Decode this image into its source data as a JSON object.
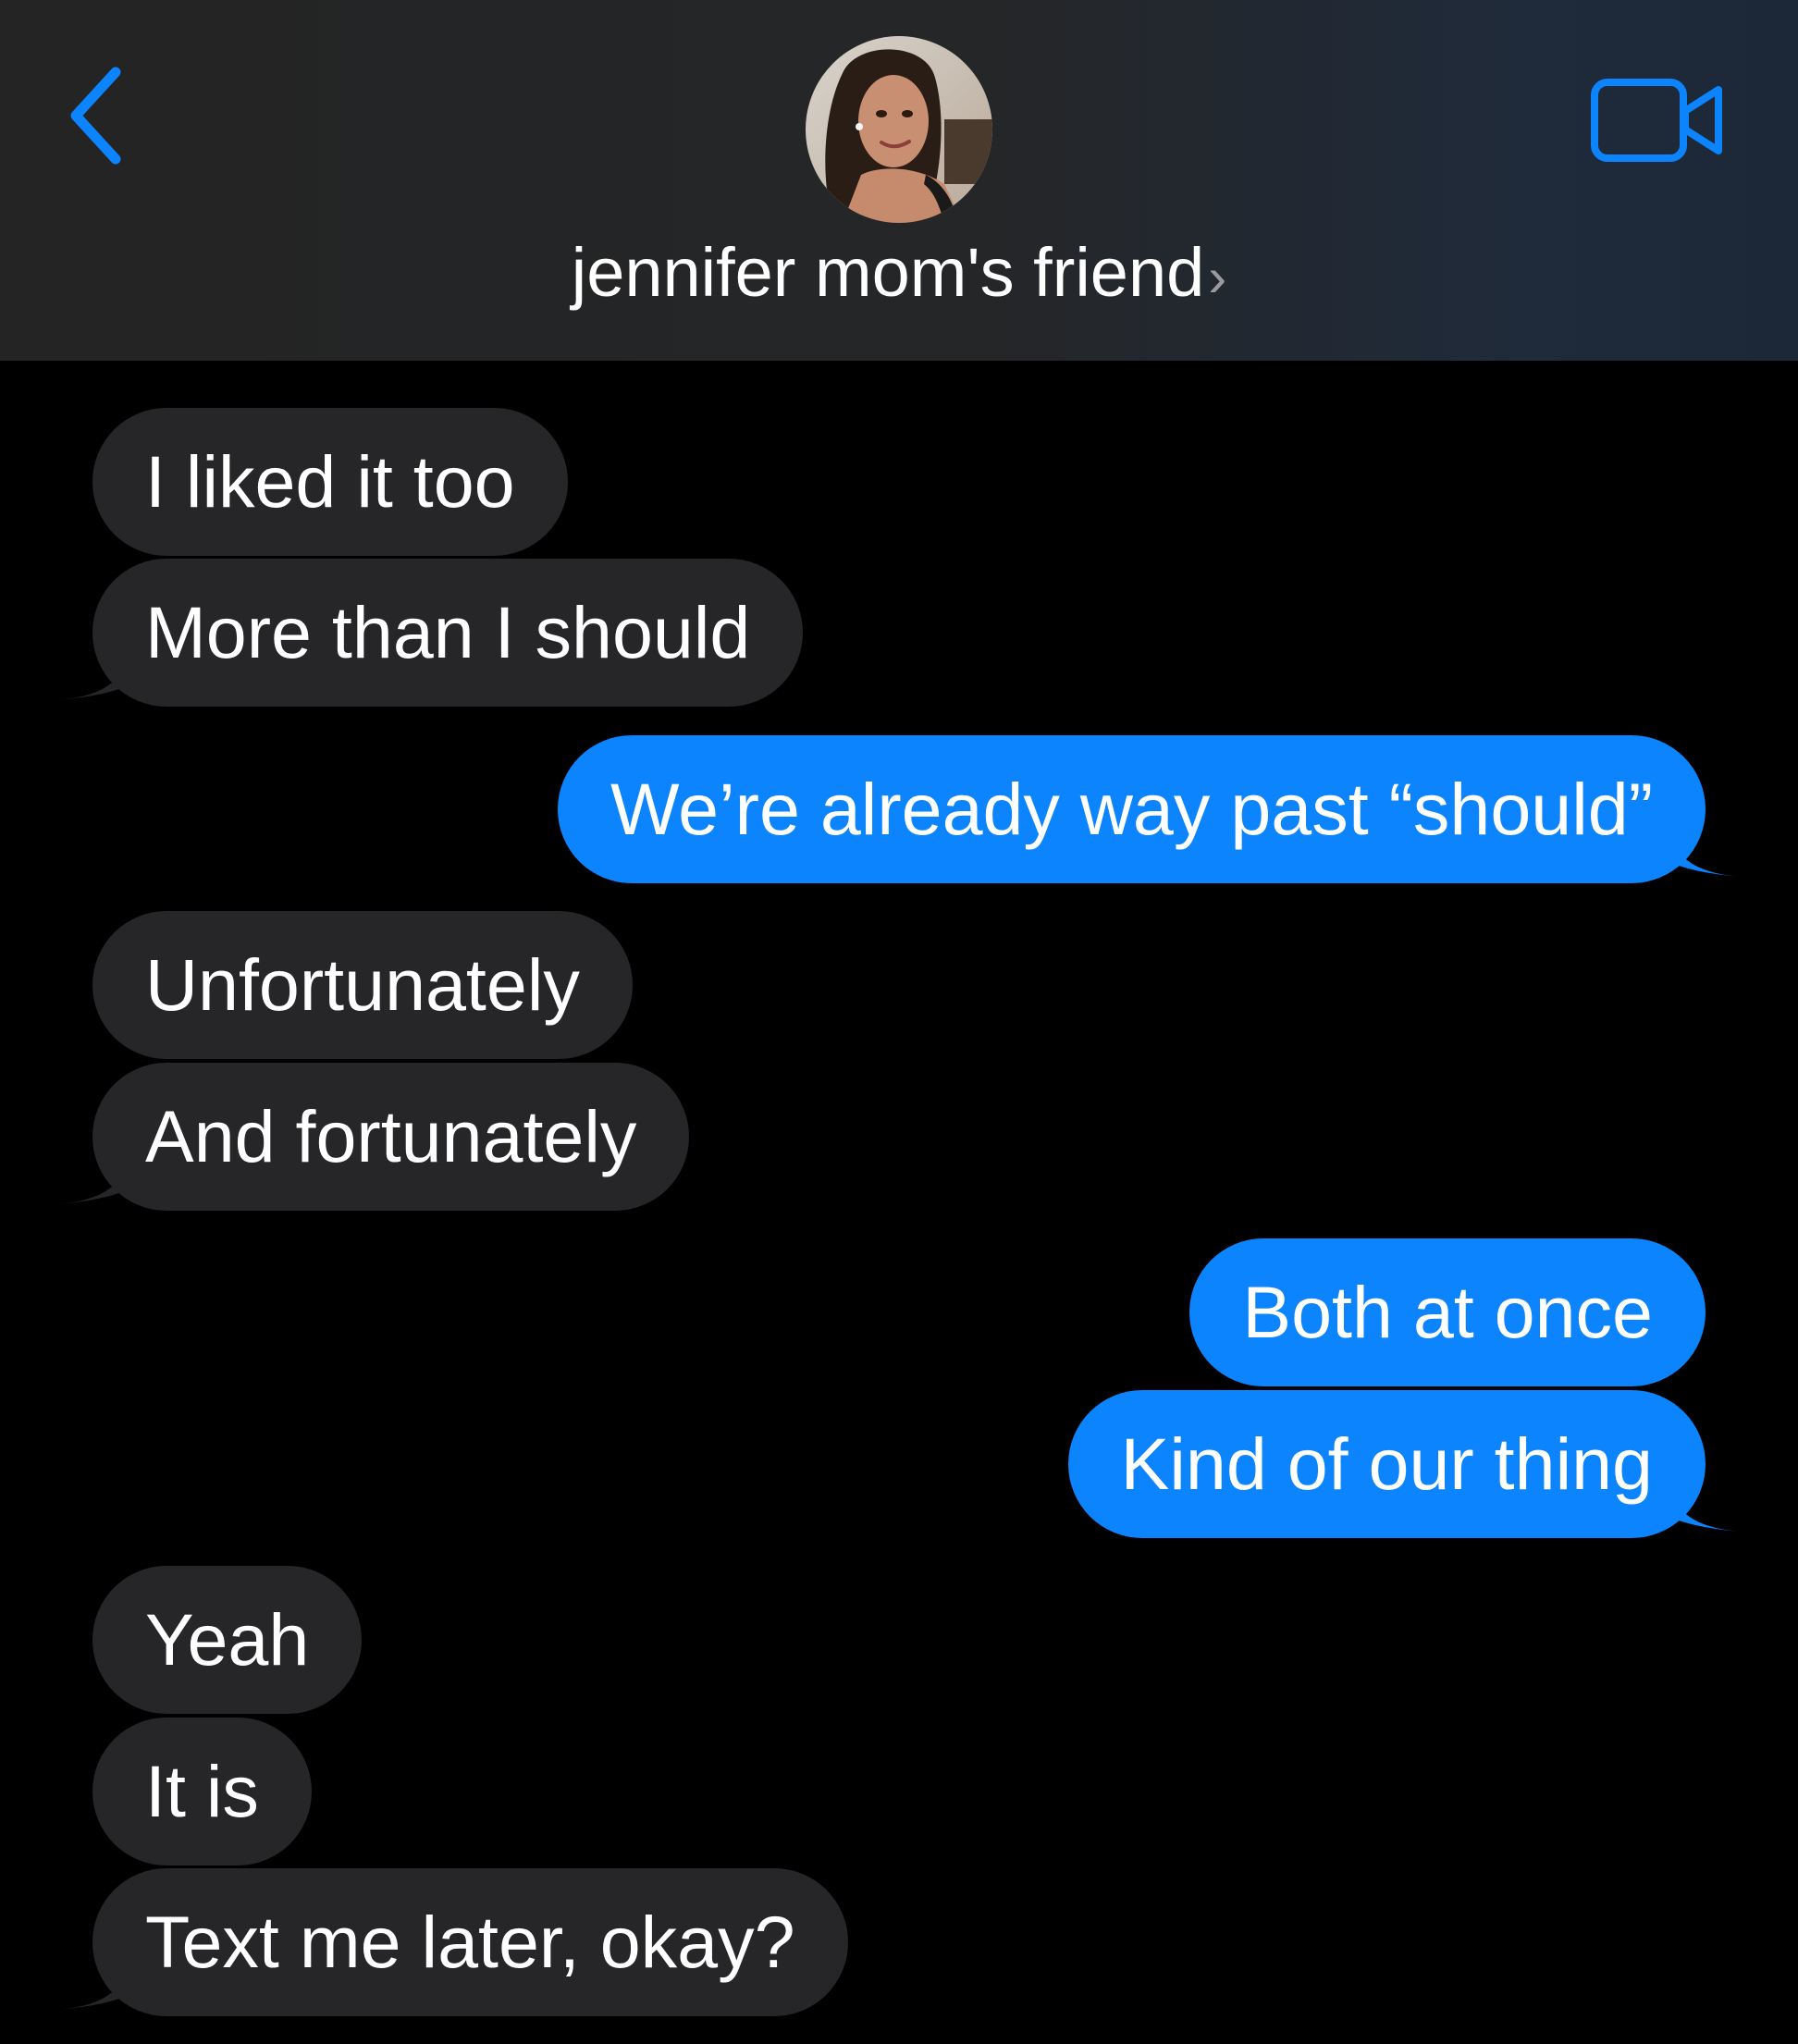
{
  "header": {
    "back_icon": "chevron-left-icon",
    "contact_name": "jennifer mom's friend",
    "name_chevron": "›",
    "video_icon": "video-camera-icon",
    "accent_color": "#0b84fe"
  },
  "messages": [
    {
      "direction": "incoming",
      "text": "I liked it too"
    },
    {
      "direction": "incoming",
      "text": "More than I should"
    },
    {
      "direction": "outgoing",
      "text": "We’re already way past “should”"
    },
    {
      "direction": "incoming",
      "text": "Unfortunately"
    },
    {
      "direction": "incoming",
      "text": "And fortunately"
    },
    {
      "direction": "outgoing",
      "text": "Both at once"
    },
    {
      "direction": "outgoing",
      "text": "Kind of our thing"
    },
    {
      "direction": "incoming",
      "text": "Yeah"
    },
    {
      "direction": "incoming",
      "text": "It is"
    },
    {
      "direction": "incoming",
      "text": "Text me later, okay?"
    }
  ],
  "colors": {
    "incoming_bubble": "#262628",
    "outgoing_bubble": "#0b84fe",
    "background": "#000000"
  }
}
